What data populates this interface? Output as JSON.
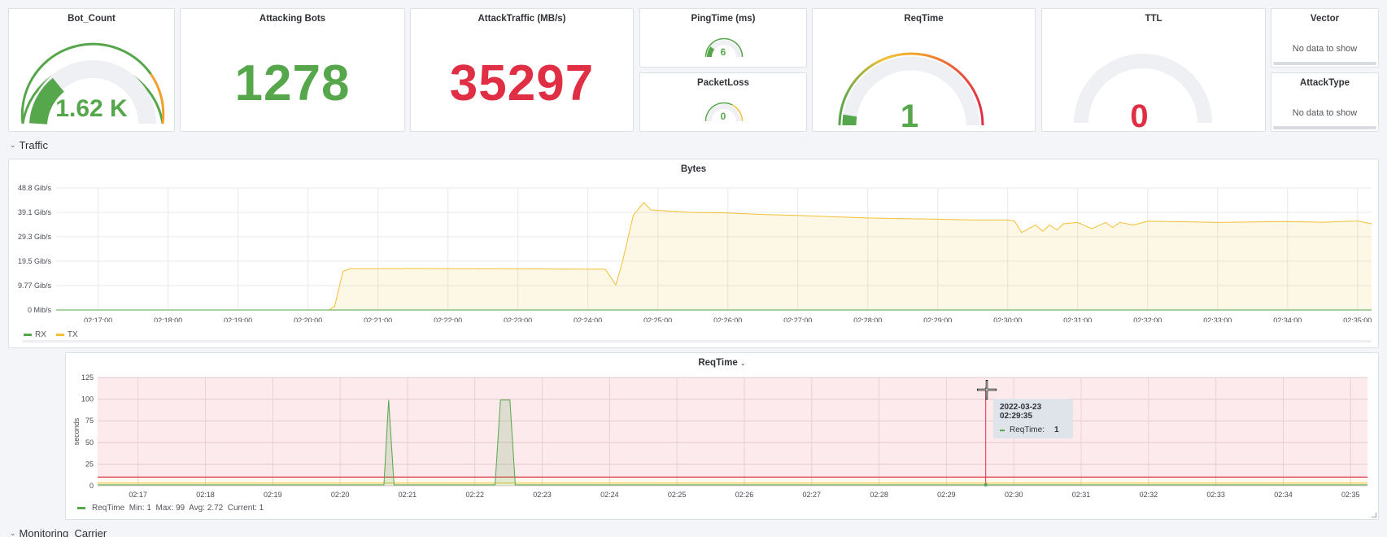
{
  "stats": {
    "bot_count": {
      "title": "Bot_Count",
      "value": "1.62 K",
      "color": "#56a64b"
    },
    "attacking_bots": {
      "title": "Attacking Bots",
      "value": "1278",
      "color": "#56a64b"
    },
    "attack_traffic": {
      "title": "AttackTraffic (MB/s)",
      "value": "35297",
      "color": "#e02f44"
    },
    "ping_time": {
      "title": "PingTime (ms)",
      "value": "6"
    },
    "packet_loss": {
      "title": "PacketLoss",
      "value": "0"
    },
    "req_time": {
      "title": "ReqTime",
      "value": "1"
    },
    "ttl": {
      "title": "TTL",
      "value": "0",
      "color": "#e02f44"
    },
    "vector": {
      "title": "Vector",
      "message": "No data to show"
    },
    "attack_type": {
      "title": "AttackType",
      "message": "No data to show"
    }
  },
  "rows": {
    "traffic": "Traffic",
    "monitoring": "Monitoring_Carrier"
  },
  "bytes_panel": {
    "title": "Bytes",
    "legend": [
      {
        "name": "RX",
        "color": "#56a64b"
      },
      {
        "name": "TX",
        "color": "#f2c037"
      }
    ]
  },
  "reqtime_panel": {
    "title": "ReqTime",
    "legend_text": "ReqTime  Min: 1  Max: 99  Avg: 2.72  Current: 1",
    "tooltip": {
      "date": "2022-03-23 02:29:35",
      "series": "ReqTime:",
      "value": "1"
    }
  },
  "chart_data": [
    {
      "type": "area",
      "title": "Bytes",
      "y_ticks": [
        "0 Mib/s",
        "9.77 Gib/s",
        "19.5 Gib/s",
        "29.3 Gib/s",
        "39.1 Gib/s",
        "48.8 Gib/s"
      ],
      "x_ticks": [
        "02:17:00",
        "02:18:00",
        "02:19:00",
        "02:20:00",
        "02:21:00",
        "02:22:00",
        "02:23:00",
        "02:24:00",
        "02:25:00",
        "02:26:00",
        "02:27:00",
        "02:28:00",
        "02:29:00",
        "02:30:00",
        "02:31:00",
        "02:32:00",
        "02:33:00",
        "02:34:00",
        "02:35:00"
      ],
      "x_range_minutes": [
        16.4,
        35.2
      ],
      "y_range_gib": [
        0,
        48.8
      ],
      "series": [
        {
          "name": "RX",
          "color": "#56a64b",
          "points": [
            [
              16.4,
              0
            ],
            [
              35.2,
              0
            ]
          ]
        },
        {
          "name": "TX",
          "color": "#f2c037",
          "points": [
            [
              16.4,
              0
            ],
            [
              20.3,
              0
            ],
            [
              20.38,
              1.5
            ],
            [
              20.5,
              15.5
            ],
            [
              20.6,
              16.5
            ],
            [
              21.5,
              16.6
            ],
            [
              22.5,
              16.5
            ],
            [
              23.5,
              16.4
            ],
            [
              24.25,
              16.3
            ],
            [
              24.4,
              10
            ],
            [
              24.5,
              20
            ],
            [
              24.65,
              38
            ],
            [
              24.8,
              43
            ],
            [
              24.9,
              40
            ],
            [
              25.5,
              39
            ],
            [
              26.0,
              38.8
            ],
            [
              26.5,
              38.2
            ],
            [
              27.0,
              37.8
            ],
            [
              27.5,
              37.3
            ],
            [
              28.0,
              36.8
            ],
            [
              28.5,
              36.5
            ],
            [
              29.0,
              36.3
            ],
            [
              29.5,
              36.0
            ],
            [
              30.0,
              36.0
            ],
            [
              30.1,
              35.5
            ],
            [
              30.2,
              31
            ],
            [
              30.3,
              32.5
            ],
            [
              30.4,
              34
            ],
            [
              30.5,
              31.5
            ],
            [
              30.6,
              34
            ],
            [
              30.7,
              32
            ],
            [
              30.8,
              34.5
            ],
            [
              31.0,
              35
            ],
            [
              31.2,
              32.5
            ],
            [
              31.4,
              35
            ],
            [
              31.5,
              33
            ],
            [
              31.6,
              35
            ],
            [
              31.8,
              34
            ],
            [
              32.0,
              35.5
            ],
            [
              32.5,
              35.3
            ],
            [
              33.0,
              35.0
            ],
            [
              33.5,
              35.2
            ],
            [
              34.0,
              35.4
            ],
            [
              34.5,
              35.1
            ],
            [
              35.0,
              35.6
            ],
            [
              35.2,
              34.5
            ]
          ]
        }
      ]
    },
    {
      "type": "area",
      "title": "ReqTime",
      "ylabel": "seconds",
      "y_ticks": [
        0,
        25,
        50,
        75,
        100,
        125
      ],
      "y_range": [
        0,
        125
      ],
      "x_ticks": [
        "02:17",
        "02:18",
        "02:19",
        "02:20",
        "02:21",
        "02:22",
        "02:23",
        "02:24",
        "02:25",
        "02:26",
        "02:27",
        "02:28",
        "02:29",
        "02:30",
        "02:31",
        "02:32",
        "02:33",
        "02:34",
        "02:35"
      ],
      "x_range_minutes": [
        16.4,
        35.25
      ],
      "thresholds": [
        {
          "value": 3,
          "color": "#f2c037"
        },
        {
          "value": 10,
          "color": "#e02f44"
        }
      ],
      "series": [
        {
          "name": "ReqTime",
          "color": "#56a64b",
          "points": [
            [
              16.4,
              1
            ],
            [
              20.65,
              1
            ],
            [
              20.72,
              99
            ],
            [
              20.8,
              1
            ],
            [
              22.3,
              1
            ],
            [
              22.38,
              99
            ],
            [
              22.52,
              99
            ],
            [
              22.6,
              1
            ],
            [
              35.25,
              1
            ]
          ]
        }
      ]
    }
  ]
}
